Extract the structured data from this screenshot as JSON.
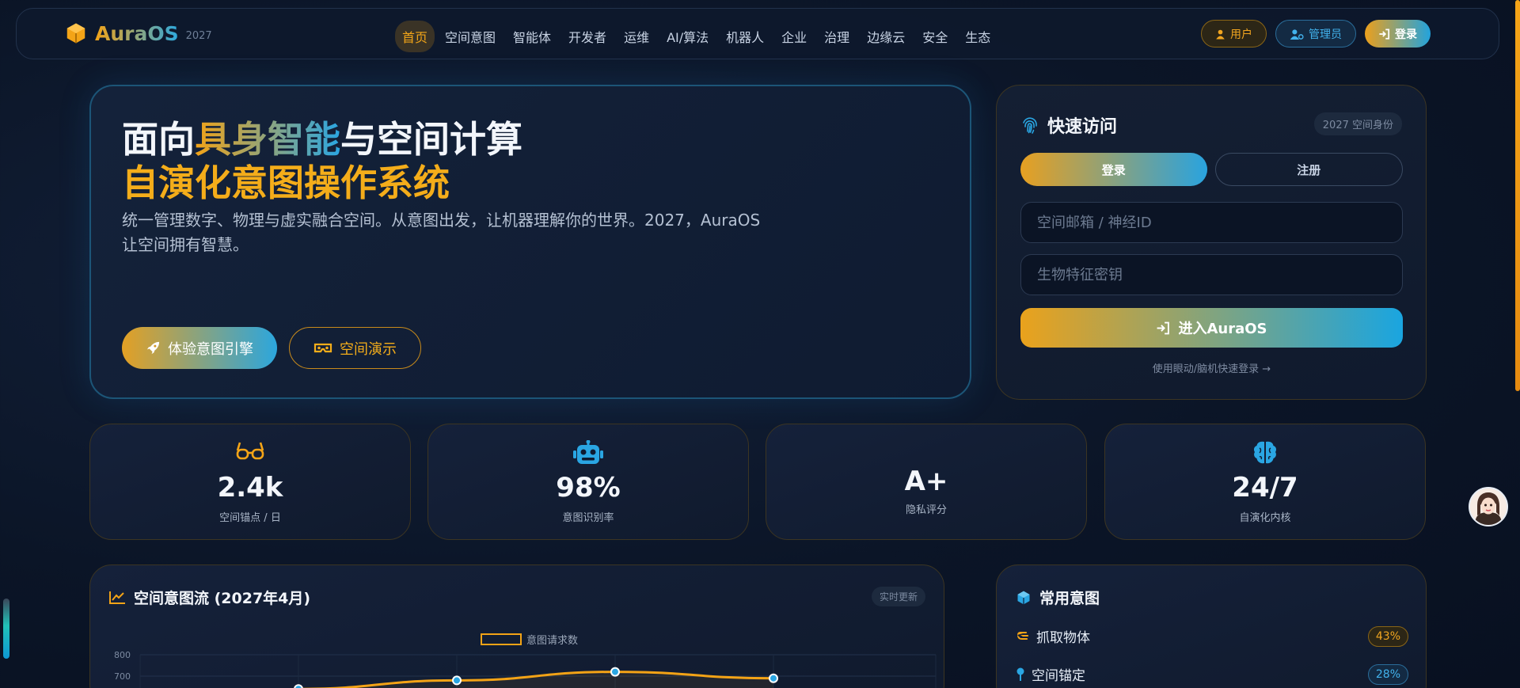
{
  "brand": {
    "name": "AuraOS",
    "year": "2027"
  },
  "nav": {
    "items": [
      "首页",
      "空间意图",
      "智能体",
      "开发者",
      "运维",
      "AI/算法",
      "机器人",
      "企业",
      "治理",
      "边缘云",
      "安全",
      "生态"
    ],
    "active_index": 0
  },
  "top_actions": {
    "user": "用户",
    "admin": "管理员",
    "login": "登录"
  },
  "hero": {
    "title_part1": "面向",
    "title_highlight": "具身智能",
    "title_part2": "与空间计算",
    "title_line2": "自演化意图操作系统",
    "description": "统一管理数字、物理与虚实融合空间。从意图出发，让机器理解你的世界。2027，AuraOS 让空间拥有智慧。",
    "primary_button": "体验意图引擎",
    "secondary_button": "空间演示"
  },
  "quick_access": {
    "title": "快速访问",
    "badge": "2027 空间身份",
    "tab_login": "登录",
    "tab_register": "注册",
    "email_placeholder": "空间邮箱 / 神经ID",
    "key_placeholder": "生物特征密钥",
    "enter_button": "进入AuraOS",
    "hint": "使用眼动/脑机快速登录 →"
  },
  "stats": [
    {
      "value": "2.4k",
      "label": "空间锚点 / 日",
      "icon": "glasses-icon"
    },
    {
      "value": "98%",
      "label": "意图识别率",
      "icon": "robot-icon"
    },
    {
      "value": "A+",
      "label": "隐私评分",
      "icon": ""
    },
    {
      "value": "24/7",
      "label": "自演化内核",
      "icon": "brain-icon"
    }
  ],
  "chart_panel": {
    "title": "空间意图流 (2027年4月)",
    "badge": "实时更新"
  },
  "chart_data": {
    "type": "line",
    "title": "",
    "series": [
      {
        "name": "意图请求数",
        "values": [
          null,
          null,
          null,
          640,
          680,
          720,
          690
        ],
        "color": "#f3a316"
      }
    ],
    "y_ticks": [
      "800",
      "700"
    ],
    "ylim": [
      0,
      800
    ],
    "grid": true,
    "legend": "top-center"
  },
  "intents": {
    "title": "常用意图",
    "items": [
      {
        "label": "抓取物体",
        "pct": "43%",
        "tone": "gold",
        "icon": "grab-hand-icon"
      },
      {
        "label": "空间锚定",
        "pct": "28%",
        "tone": "blue",
        "icon": "map-pin-icon"
      }
    ]
  },
  "colors": {
    "accent_gold": "#f3a316",
    "accent_blue": "#2aa6e3",
    "background": "#0b1527"
  }
}
